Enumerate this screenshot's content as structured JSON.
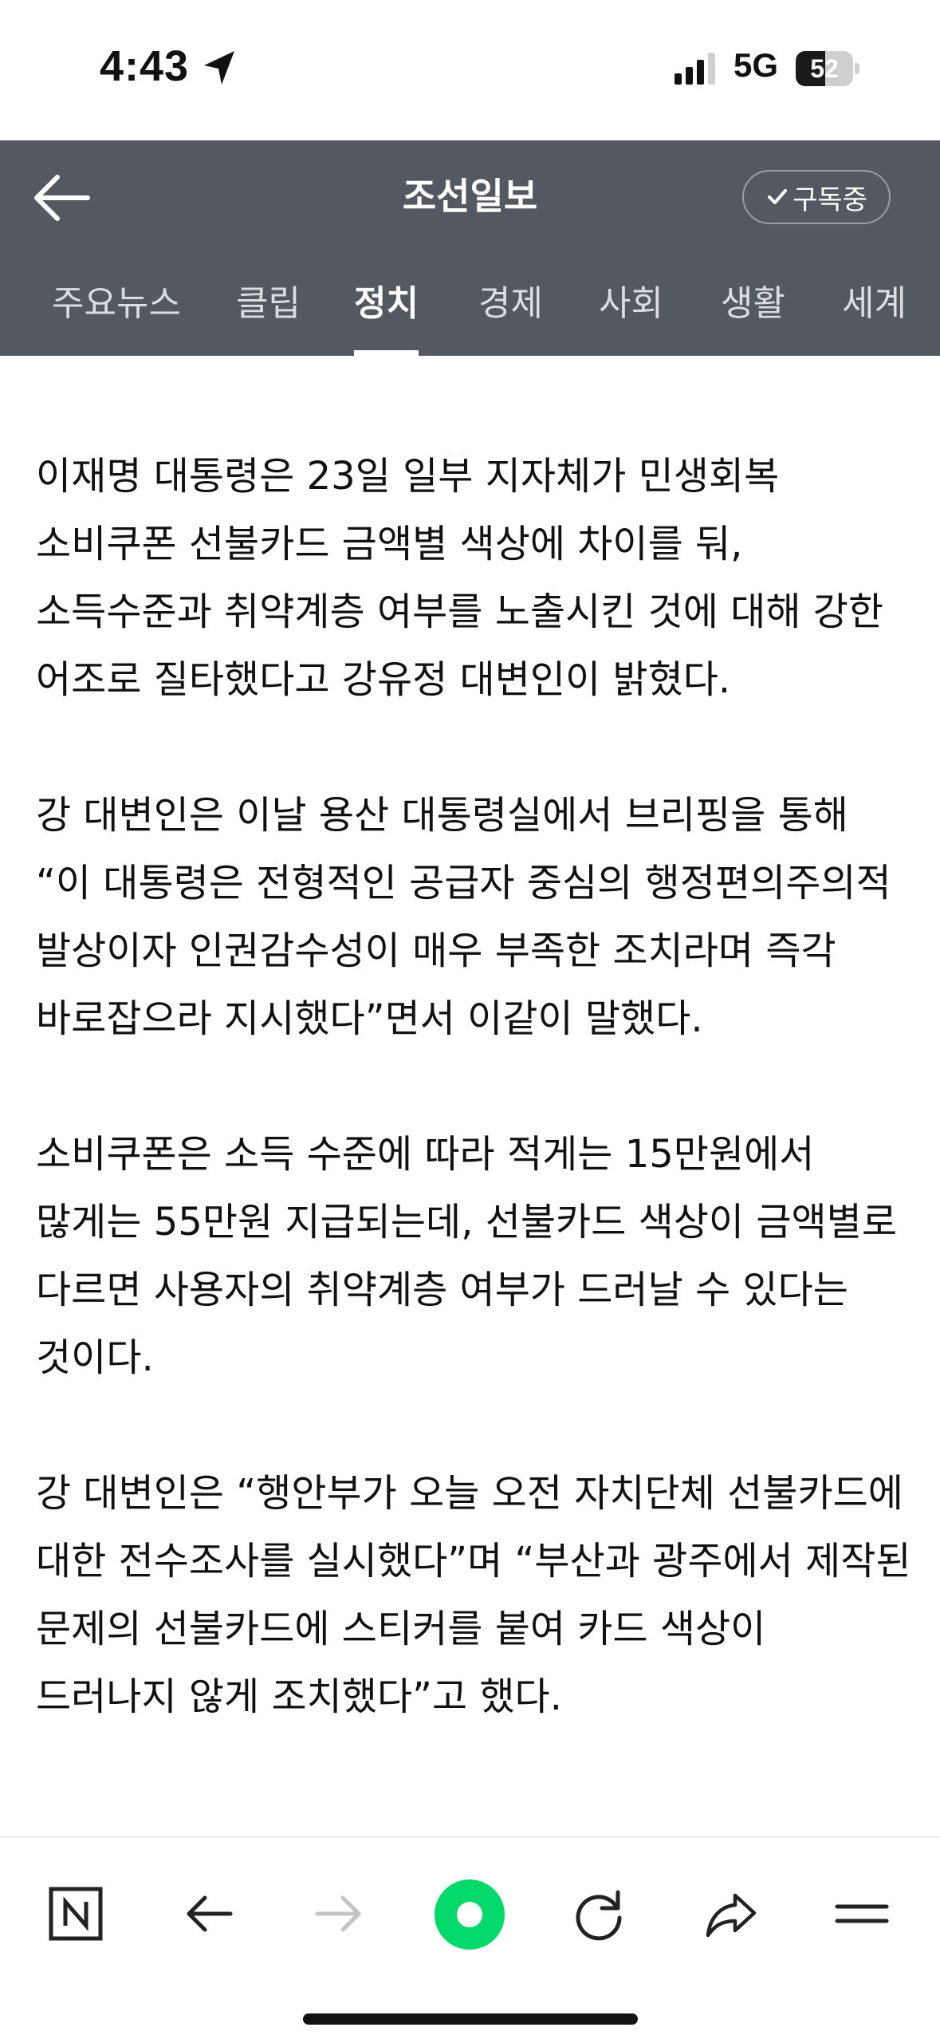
{
  "status_bar": {
    "time": "4:43",
    "network": "5G",
    "battery": "52",
    "battery_level": 0.52
  },
  "header": {
    "title": "조선일보",
    "subscribe_label": "구독중"
  },
  "tabs": [
    {
      "label": "주요뉴스",
      "active": false
    },
    {
      "label": "클립",
      "active": false
    },
    {
      "label": "정치",
      "active": true
    },
    {
      "label": "경제",
      "active": false
    },
    {
      "label": "사회",
      "active": false
    },
    {
      "label": "생활",
      "active": false
    },
    {
      "label": "세계",
      "active": false
    }
  ],
  "article": {
    "paragraphs": [
      "이재명 대통령은 23일 일부 지자체가 민생회복 소비쿠폰 선불카드 금액별 색상에 차이를 둬, 소득수준과 취약계층 여부를 노출시킨 것에 대해 강한 어조로 질타했다고 강유정 대변인이 밝혔다.",
      "강 대변인은 이날 용산 대통령실에서 브리핑을 통해 “이 대통령은 전형적인 공급자 중심의 행정편의주의적 발상이자 인권감수성이 매우 부족한 조치라며 즉각 바로잡으라 지시했다”면서 이같이 말했다.",
      "소비쿠폰은 소득 수준에 따라 적게는 15만원에서 많게는 55만원 지급되는데, 선불카드 색상이 금액별로 다르면 사용자의 취약계층 여부가 드러날 수 있다는 것이다.",
      "강 대변인은 “행안부가 오늘 오전 자치단체 선불카드에 대한 전수조사를 실시했다”며 “부산과 광주에서 제작된 문제의 선불카드에 스티커를 붙여 카드 색상이 드러나지 않게 조치했다”고 했다."
    ]
  },
  "toolbar": {
    "items": [
      "naver-home-icon",
      "back-icon",
      "forward-icon",
      "green-dot-icon",
      "reload-icon",
      "share-icon",
      "menu-icon"
    ],
    "accent_color": "#03d86a"
  },
  "colors": {
    "header_bg": "#545961",
    "text": "#111111"
  }
}
